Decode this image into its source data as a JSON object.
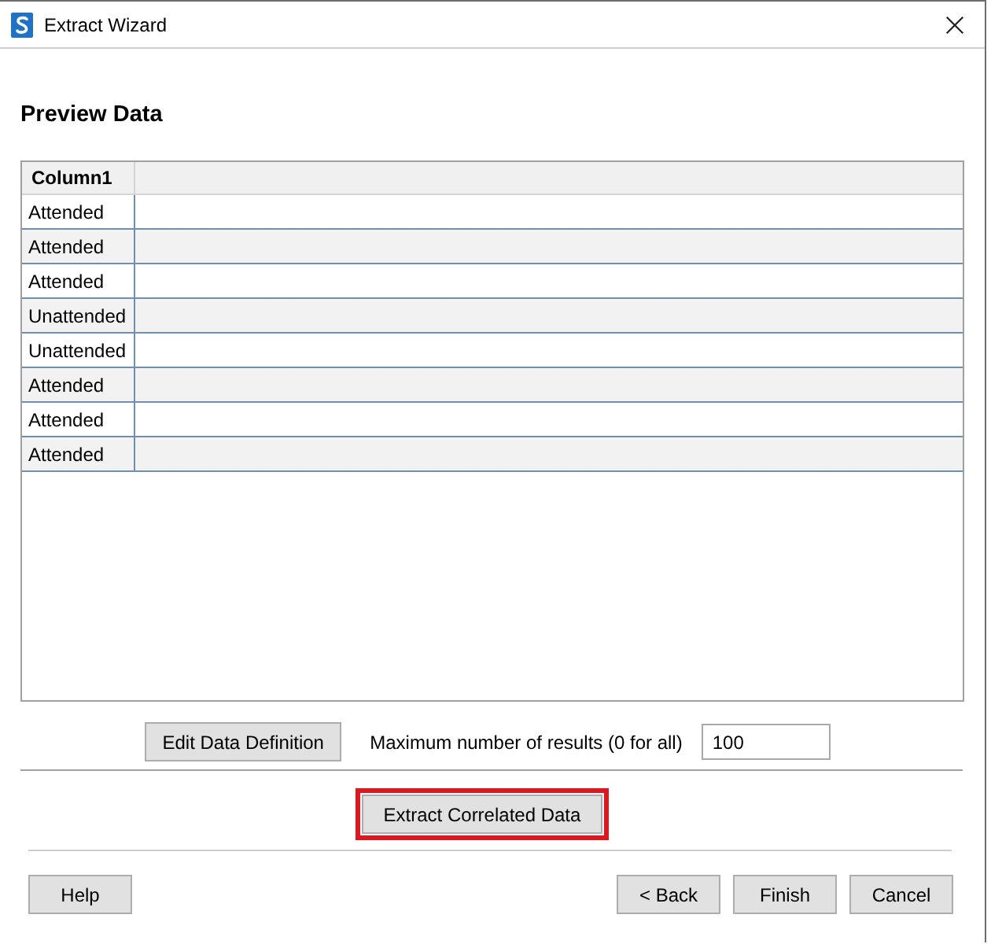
{
  "window": {
    "title": "Extract Wizard"
  },
  "heading": "Preview Data",
  "table": {
    "columns": [
      "Column1"
    ],
    "rows": [
      [
        "Attended"
      ],
      [
        "Attended"
      ],
      [
        "Attended"
      ],
      [
        "Unattended"
      ],
      [
        "Unattended"
      ],
      [
        "Attended"
      ],
      [
        "Attended"
      ],
      [
        "Attended"
      ]
    ]
  },
  "limit": {
    "button": "Edit Data Definition",
    "label": "Maximum number of results (0 for all)",
    "value": "100"
  },
  "extract_button": {
    "label": "Extract Correlated Data",
    "highlighted": true
  },
  "footer": {
    "left_buttons": [
      "Help"
    ],
    "right_buttons": [
      "< Back",
      "Finish",
      "Cancel"
    ]
  }
}
